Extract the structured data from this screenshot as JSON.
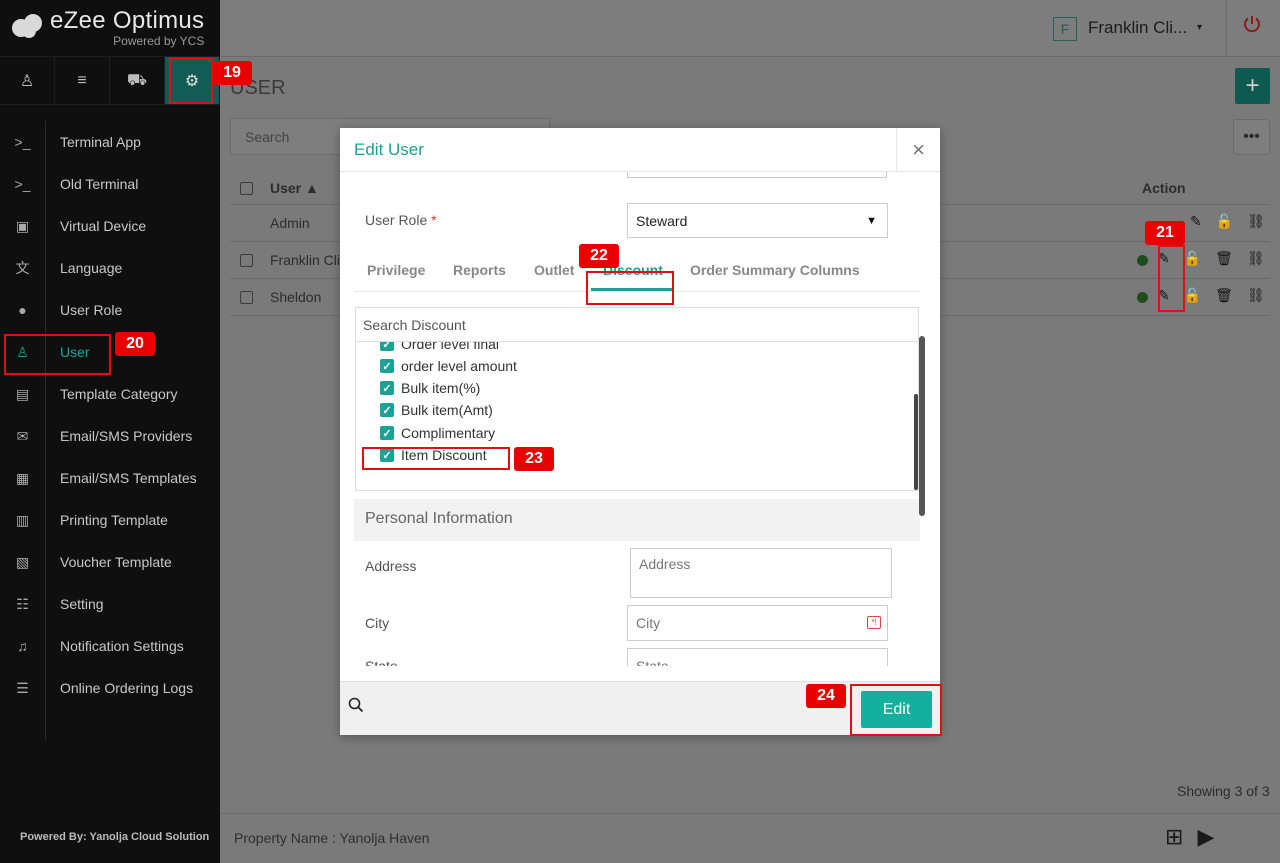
{
  "app": {
    "brand_title": "eZee Optimus",
    "brand_sub": "Powered by YCS",
    "powered_by": "Powered By: Yanolja Cloud Solution"
  },
  "topbar": {
    "property_initial": "F",
    "property_name": "Franklin Cli...",
    "caret": "▾",
    "power_icon": "power-icon"
  },
  "icon_tabs": [
    {
      "name": "profile-icon",
      "glyph": "♙"
    },
    {
      "name": "menu-icon",
      "glyph": "≡"
    },
    {
      "name": "cart-icon",
      "glyph": "⛟"
    },
    {
      "name": "settings-icon",
      "glyph": "⚙"
    }
  ],
  "sidebar": {
    "items": [
      {
        "label": "Terminal App",
        "icon": ">_"
      },
      {
        "label": "Old Terminal",
        "icon": ">_"
      },
      {
        "label": "Virtual Device",
        "icon": "▣"
      },
      {
        "label": "Language",
        "icon": "文"
      },
      {
        "label": "User Role",
        "icon": "●"
      },
      {
        "label": "User",
        "icon": "♙"
      },
      {
        "label": "Template Category",
        "icon": "▤"
      },
      {
        "label": "Email/SMS Providers",
        "icon": "✉"
      },
      {
        "label": "Email/SMS Templates",
        "icon": "▦"
      },
      {
        "label": "Printing Template",
        "icon": "▥"
      },
      {
        "label": "Voucher Template",
        "icon": "▧"
      },
      {
        "label": "Setting",
        "icon": "☷"
      },
      {
        "label": "Notification Settings",
        "icon": "♫"
      },
      {
        "label": "Online Ordering Logs",
        "icon": "☰"
      }
    ]
  },
  "page": {
    "title": "USER",
    "search_placeholder": "Search",
    "col_user": "User ▲",
    "col_action": "Action",
    "rows": [
      {
        "name": "Admin"
      },
      {
        "name": "Franklin Cli"
      },
      {
        "name": "Sheldon"
      }
    ],
    "showing": "Showing 3 of 3",
    "property_footer": "Property Name : Yanolja Haven"
  },
  "modal": {
    "title": "Edit User",
    "close": "×",
    "user_role_label": "User Role",
    "user_role_required": "*",
    "user_role_value": "Steward",
    "tabs": [
      "Privilege",
      "Reports",
      "Outlet",
      "Discount",
      "Order Summary Columns"
    ],
    "active_tab": "Discount",
    "discount_search_placeholder": "Search Discount",
    "discounts": [
      {
        "label": "Order level final",
        "checked": true
      },
      {
        "label": "order level amount",
        "checked": true
      },
      {
        "label": "Bulk item(%)",
        "checked": true
      },
      {
        "label": "Bulk item(Amt)",
        "checked": true
      },
      {
        "label": "Complimentary",
        "checked": true
      },
      {
        "label": "Item Discount",
        "checked": true
      }
    ],
    "section_personal": "Personal Information",
    "address_label": "Address",
    "address_placeholder": "Address",
    "city_label": "City",
    "city_placeholder": "City",
    "state_label": "State",
    "state_placeholder": "State",
    "edit_button": "Edit"
  },
  "callouts": [
    "19",
    "20",
    "21",
    "22",
    "23",
    "24"
  ],
  "colors": {
    "accent": "#1aa394",
    "callout": "#e80000",
    "sidebar_bg": "#0f0f0f"
  }
}
